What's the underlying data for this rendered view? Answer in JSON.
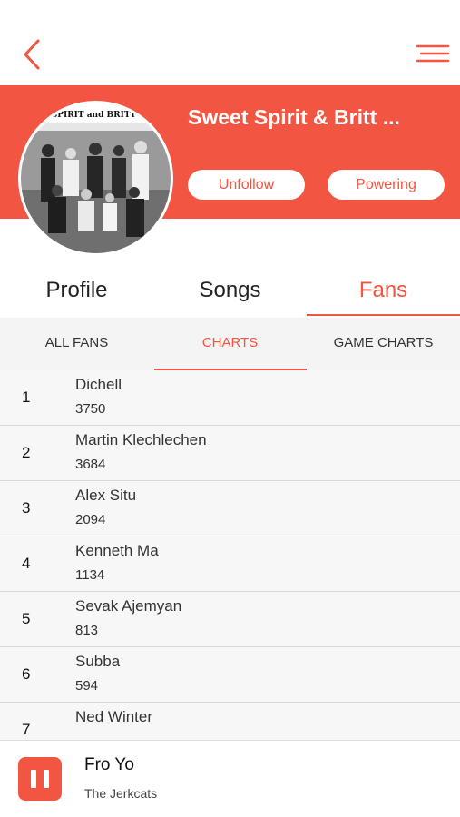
{
  "colors": {
    "accent": "#f25541",
    "list_bg": "#f7f7f7"
  },
  "nav": {
    "back_icon": "chevron-left-icon",
    "menu_icon": "hamburger-menu-icon"
  },
  "artist": {
    "name": "Sweet Spirit & Britt ...",
    "photo_caption": "SWEET SPIRIT and BRITT DANIEL",
    "unfollow_label": "Unfollow",
    "powering_label": "Powering"
  },
  "main_tabs": [
    {
      "label": "Profile",
      "active": false
    },
    {
      "label": "Songs",
      "active": false
    },
    {
      "label": "Fans",
      "active": true
    }
  ],
  "sub_tabs": [
    {
      "label": "ALL FANS",
      "active": false
    },
    {
      "label": "CHARTS",
      "active": true
    },
    {
      "label": "GAME CHARTS",
      "active": false
    }
  ],
  "fans": [
    {
      "rank": "1",
      "name": "Dichell",
      "score": "3750"
    },
    {
      "rank": "2",
      "name": "Martin Klechlechen",
      "score": "3684"
    },
    {
      "rank": "3",
      "name": "Alex Situ",
      "score": "2094"
    },
    {
      "rank": "4",
      "name": "Kenneth Ma",
      "score": "1134"
    },
    {
      "rank": "5",
      "name": "Sevak Ajemyan",
      "score": "813"
    },
    {
      "rank": "6",
      "name": "Subba",
      "score": "594"
    },
    {
      "rank": "7",
      "name": "Ned Winter",
      "score": ""
    }
  ],
  "player": {
    "song": "Fro Yo",
    "artist": "The Jerkcats",
    "pause_icon": "pause-icon"
  }
}
